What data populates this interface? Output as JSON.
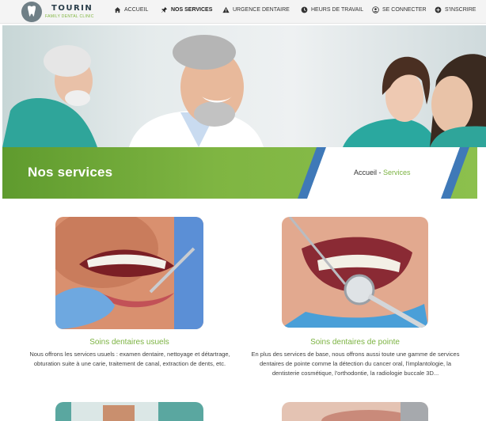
{
  "brand": {
    "name": "TOURIN",
    "tagline": "FAMILY DENTAL CLINIC"
  },
  "nav": {
    "items": [
      {
        "label": "ACCUEIL",
        "icon": "home-icon"
      },
      {
        "label": "NOS SERVICES",
        "icon": "pin-icon",
        "active": true
      },
      {
        "label": "URGENCE DENTAIRE",
        "icon": "warning-icon"
      },
      {
        "label": "HEURS DE TRAVAIL",
        "icon": "clock-icon"
      },
      {
        "label": "SE CONNECTER",
        "icon": "user-icon"
      },
      {
        "label": "S'INSCRIRE",
        "icon": "plus-circle-icon"
      }
    ]
  },
  "banner": {
    "title": "Nos services",
    "breadcrumb_home": "Accueil",
    "breadcrumb_separator": " - ",
    "breadcrumb_current": "Services"
  },
  "services": [
    {
      "title": "Soins dentaires usuels",
      "description": "Nous offrons les services usuels : examen dentaire, nettoyage et détartrage, obturation suite à une carie, traitement de canal, extraction de dents, etc."
    },
    {
      "title": "Soins dentaires de pointe",
      "description": "En plus des services de base, nous offrons aussi toute une gamme de services dentaires de pointe comme la détection du cancer oral, l'implantologie, la dentisterie cosmétique, l'orthodontie, la radiologie buccale 3D..."
    }
  ],
  "colors": {
    "accent_green": "#7cb342",
    "dark_green": "#5f9b2e",
    "accent_blue": "#3b6fb5",
    "navbar_bg": "#f4f4f4"
  }
}
